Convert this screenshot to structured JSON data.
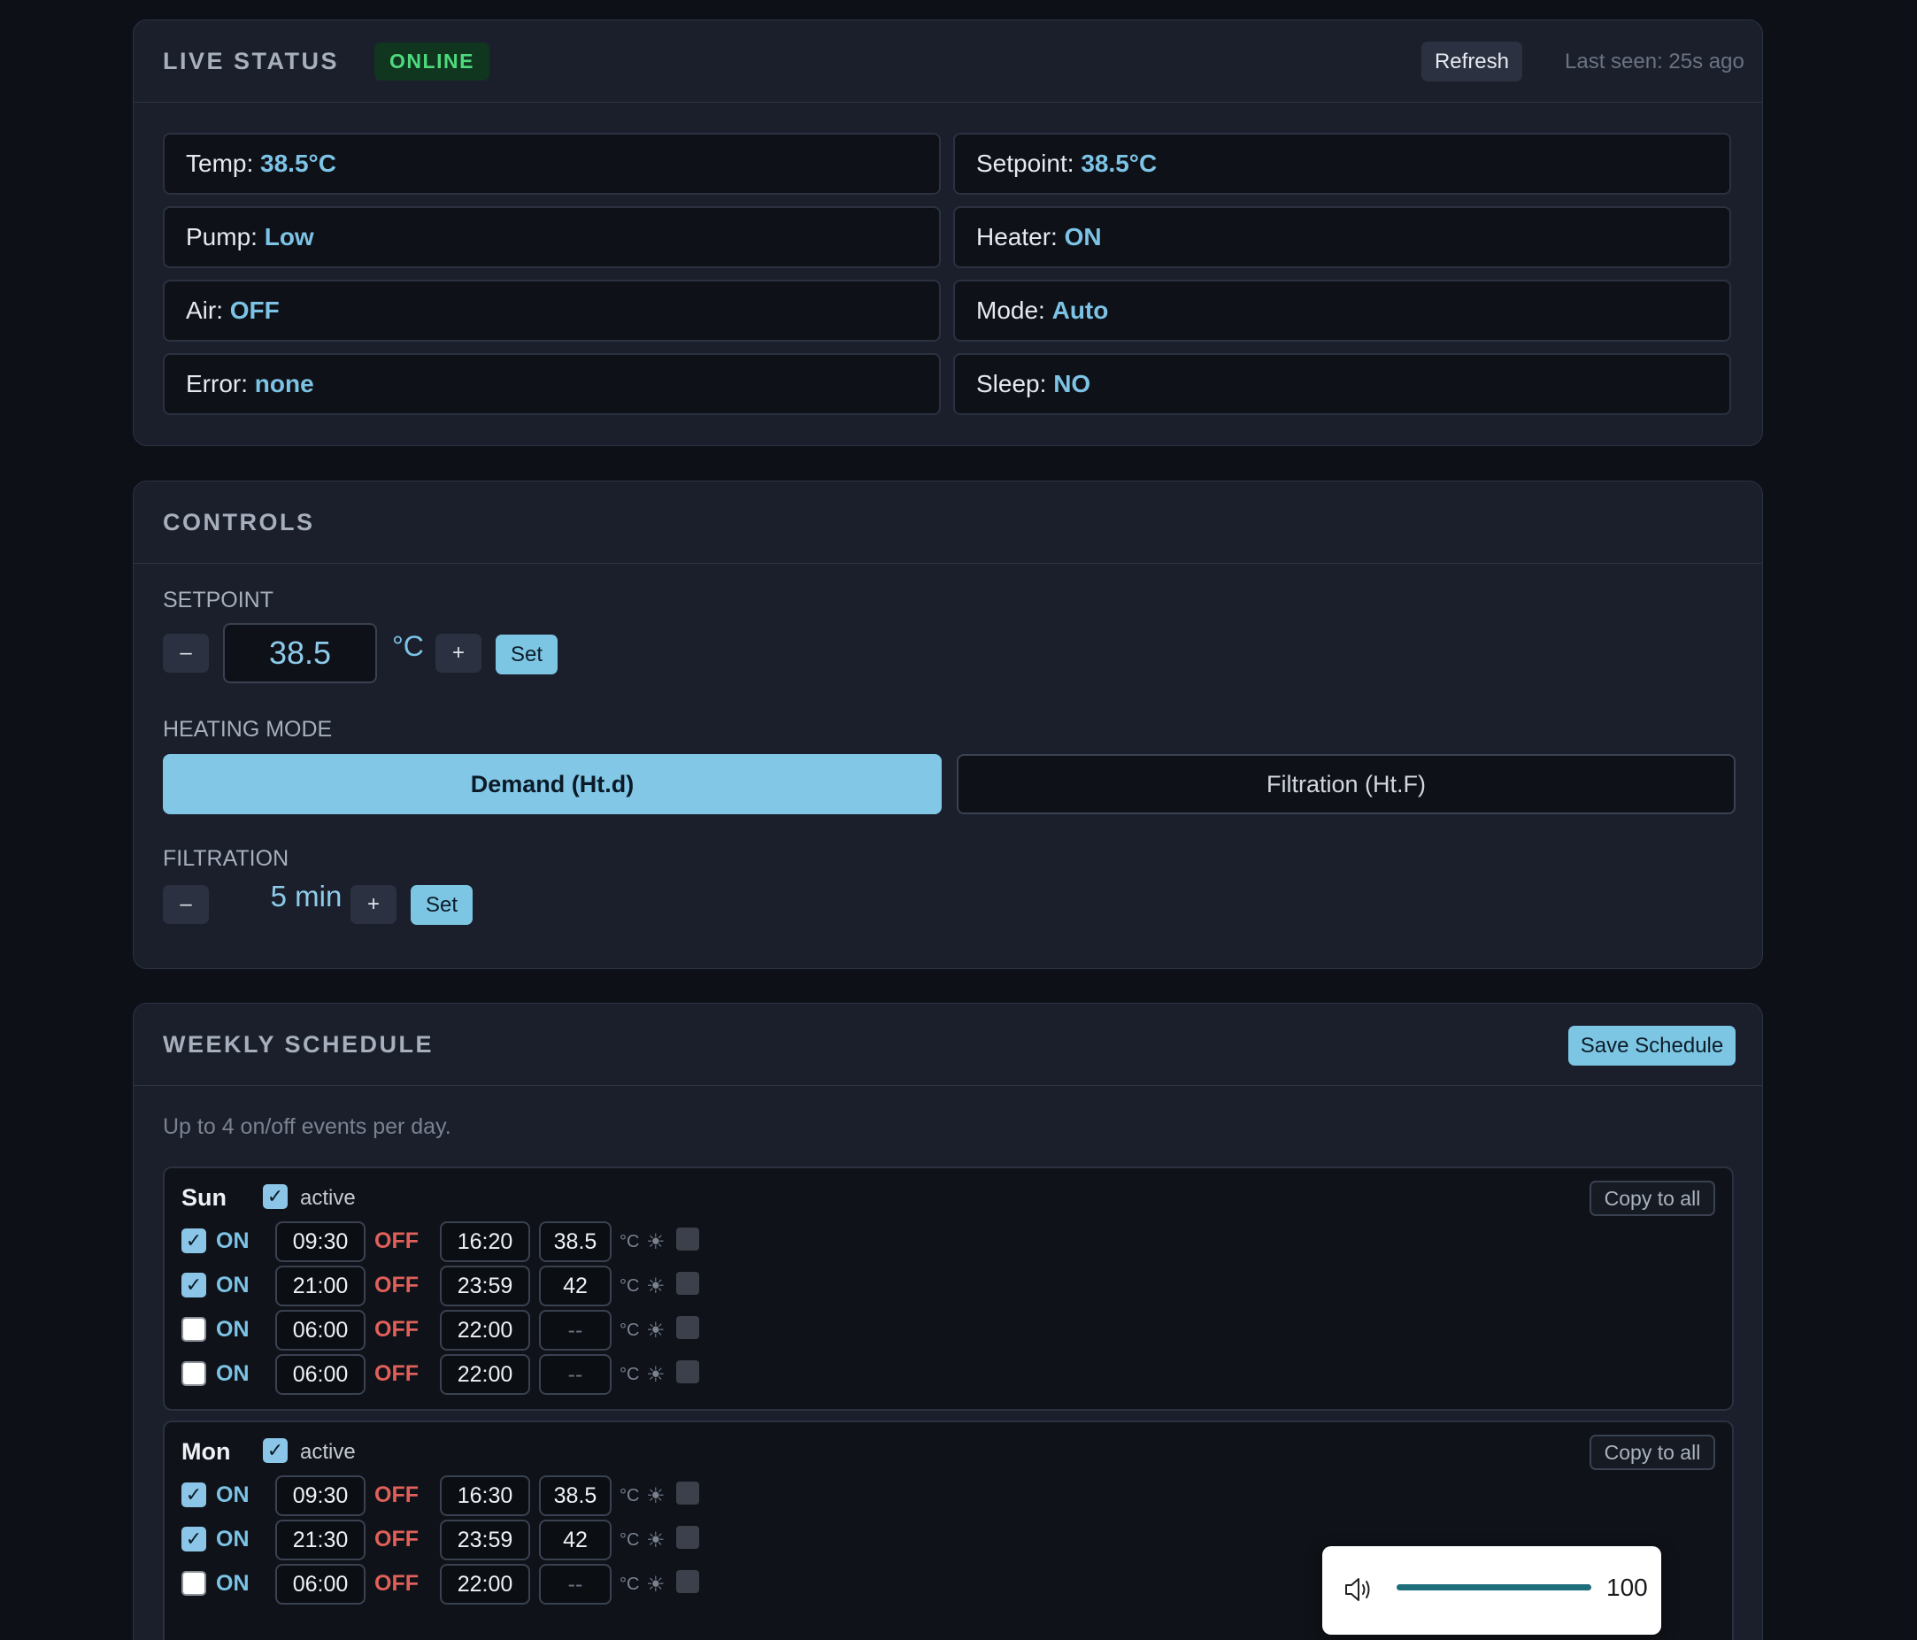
{
  "status": {
    "title": "LIVE STATUS",
    "badge": "ONLINE",
    "refresh_label": "Refresh",
    "last_seen": "Last seen: 25s ago",
    "items": [
      {
        "label": "Temp:",
        "value": "38.5°C"
      },
      {
        "label": "Setpoint:",
        "value": "38.5°C"
      },
      {
        "label": "Pump:",
        "value": "Low"
      },
      {
        "label": "Heater:",
        "value": "ON"
      },
      {
        "label": "Air:",
        "value": "OFF"
      },
      {
        "label": "Mode:",
        "value": "Auto"
      },
      {
        "label": "Error:",
        "value": "none"
      },
      {
        "label": "Sleep:",
        "value": "NO"
      }
    ]
  },
  "controls": {
    "title": "CONTROLS",
    "setpoint_label": "SETPOINT",
    "minus": "–",
    "plus": "+",
    "setpoint_value": "38.5",
    "unit": "°C",
    "set_label": "Set",
    "heating_mode_label": "HEATING MODE",
    "mode_demand": "Demand (Ht.d)",
    "mode_filtration": "Filtration (Ht.F)",
    "filtration_label": "FILTRATION",
    "filtration_value": "5 min"
  },
  "schedule": {
    "title": "WEEKLY SCHEDULE",
    "save_label": "Save Schedule",
    "note": "Up to 4 on/off events per day.",
    "active_label": "active",
    "copy_label": "Copy to all",
    "on_label": "ON",
    "off_label": "OFF",
    "unit": "°C",
    "days": [
      {
        "name": "Sun",
        "events": [
          {
            "on_time": "09:30",
            "off_time": "16:20",
            "temp": "38.5"
          },
          {
            "on_time": "21:00",
            "off_time": "23:59",
            "temp": "42"
          },
          {
            "on_time": "06:00",
            "off_time": "22:00",
            "temp": "--"
          },
          {
            "on_time": "06:00",
            "off_time": "22:00",
            "temp": "--"
          }
        ]
      },
      {
        "name": "Mon",
        "events": [
          {
            "on_time": "09:30",
            "off_time": "16:30",
            "temp": "38.5"
          },
          {
            "on_time": "21:30",
            "off_time": "23:59",
            "temp": "42"
          },
          {
            "on_time": "06:00",
            "off_time": "22:00",
            "temp": "--"
          }
        ]
      }
    ]
  },
  "volume": {
    "value": "100",
    "level": 1.0
  },
  "colors": {
    "accent": "#7cc6e4",
    "online": "#4fd97e",
    "off": "#e0605a"
  }
}
